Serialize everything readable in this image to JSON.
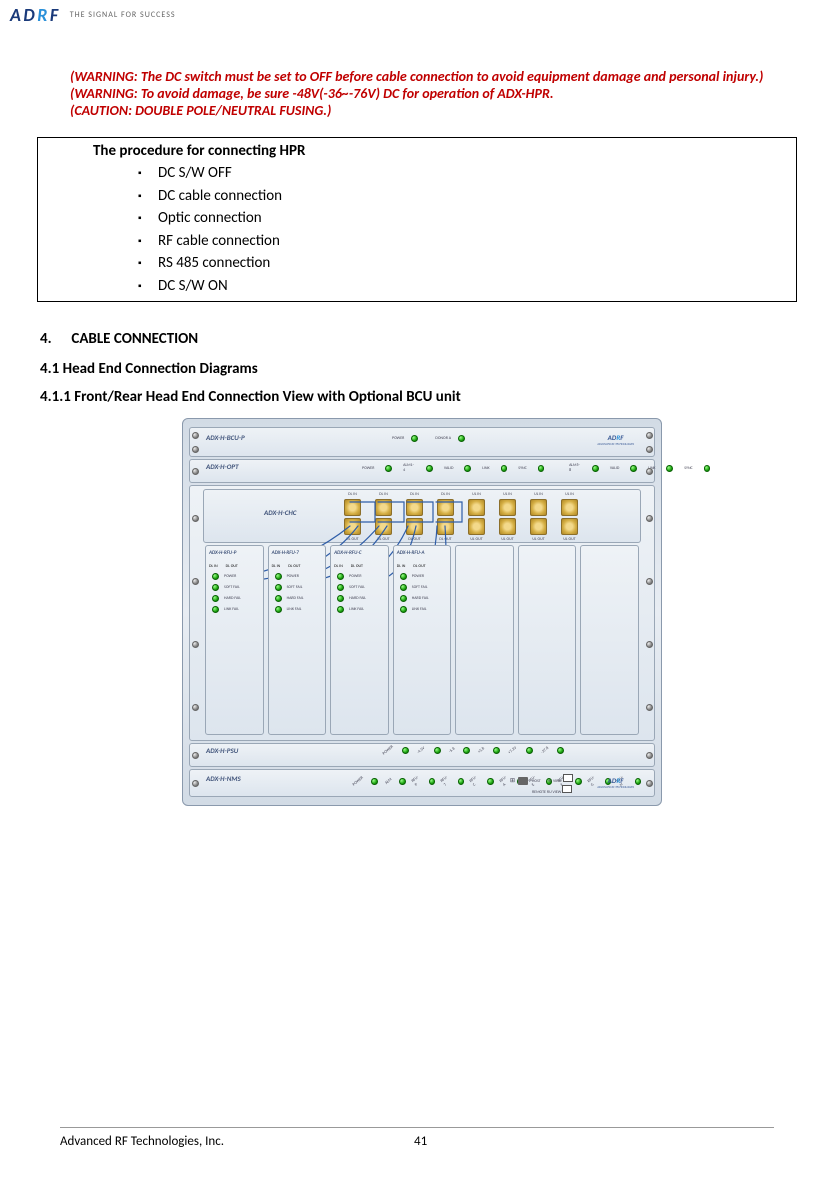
{
  "header": {
    "logo": "ADRF",
    "tagline": "THE SIGNAL FOR SUCCESS"
  },
  "warnings": {
    "w1": "(WARNING: The DC switch must be set to OFF before cable connection to avoid equipment damage and personal injury.)",
    "w2": "(WARNING: To avoid damage, be sure -48V(-36~-76V) DC for operation of ADX-HPR.",
    "w3": "(CAUTION: DOUBLE POLE/NEUTRAL FUSING.)"
  },
  "procedure": {
    "title": "The procedure for connecting HPR",
    "items": [
      "DC  S/W OFF",
      "DC cable connection",
      "Optic connection",
      "RF cable connection",
      "RS 485 connection",
      "DC  S/W ON"
    ]
  },
  "sections": {
    "s4_num": "4.",
    "s4_title": "CABLE CONNECTION",
    "s41": "4.1   Head End Connection Diagrams",
    "s411": "4.1.1      Front/Rear Head End Connection View with Optional BCU unit"
  },
  "diagram": {
    "units": {
      "bcu": "ADX-H-BCU-P",
      "bcu_leds": [
        "POWER",
        "DONOR A"
      ],
      "opt": "ADX-H-OPT",
      "opt_leds": [
        "POWER",
        "ALM1-4",
        "VALID",
        "LINK",
        "SYNC",
        "ALM5-8",
        "VALID",
        "LINK",
        "SYNC"
      ],
      "chc": "ADX-H-CHC",
      "chc_top_ports": [
        "DL IN",
        "DL IN",
        "DL IN",
        "DL IN",
        "UL IN",
        "UL IN",
        "UL IN",
        "UL IN"
      ],
      "chc_bot_ports": [
        "DL OUT",
        "DL OUT",
        "DL OUT",
        "DL OUT",
        "UL OUT",
        "UL OUT",
        "UL OUT",
        "UL OUT"
      ],
      "rfu": [
        "ADX-H-RFU-P",
        "ADX-H-RFU-7",
        "ADX-H-RFU-C",
        "ADX-H-RFU-A",
        "",
        "",
        ""
      ],
      "rfu_leds": [
        "POWER",
        "SOFT FAIL",
        "HARD FAIL",
        "LINK FAIL"
      ],
      "rfu_sub": [
        "DL IN",
        "DL OUT"
      ],
      "psu": "ADX-H-PSU",
      "psu_leds": [
        "POWER",
        "-4.5V",
        "-5.8",
        "+5.8",
        "+7.2V",
        "-27.8"
      ],
      "nms": "ADX-H-NMS",
      "nms_leds": [
        "POWER",
        "ALM",
        "RFU-P",
        "RFU-7",
        "RFU-C",
        "RFU-A",
        "RFU-E",
        "RFU-F",
        "RFU-G",
        "RFU-H"
      ],
      "nms_host": "HOST",
      "nms_he": "HE VIEW",
      "nms_remote": "REMOTE RU VIEW"
    },
    "brand_sub": "ADVANCED RF TECHNOLOGIES"
  },
  "footer": {
    "company": "Advanced RF Technologies, Inc.",
    "page": "41"
  }
}
